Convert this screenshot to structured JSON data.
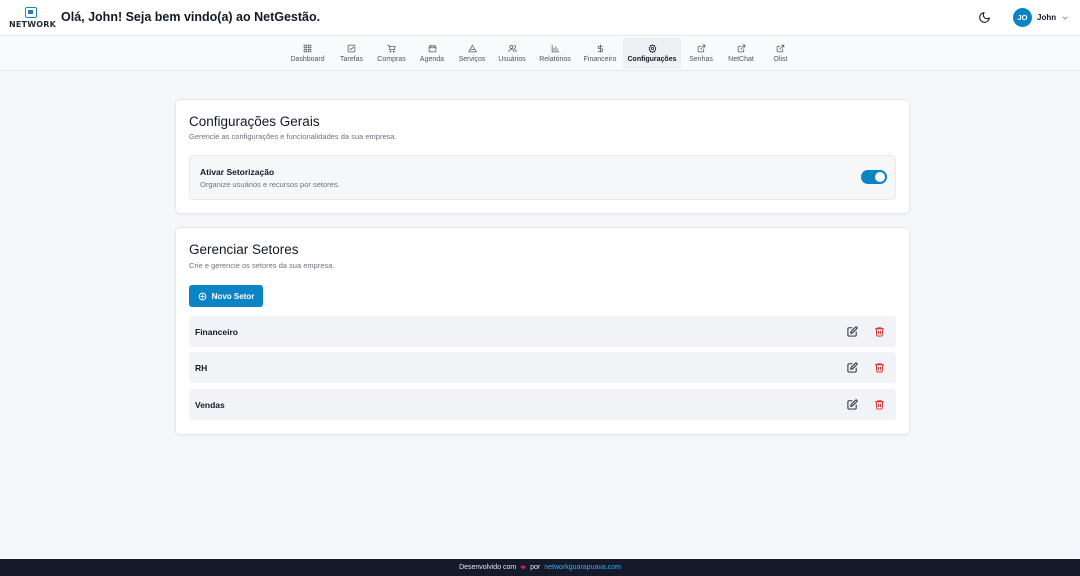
{
  "header": {
    "logo_text": "NETWORK",
    "greeting": "Olá, John! Seja bem vindo(a) ao NetGestão.",
    "user": {
      "initials": "JO",
      "name": "John"
    }
  },
  "nav": {
    "items": [
      {
        "label": "Dashboard",
        "icon": "dashboard-icon"
      },
      {
        "label": "Tarefas",
        "icon": "edit-icon"
      },
      {
        "label": "Compras",
        "icon": "cart-icon"
      },
      {
        "label": "Agenda",
        "icon": "calendar-icon"
      },
      {
        "label": "Serviços",
        "icon": "triangle-icon"
      },
      {
        "label": "Usuários",
        "icon": "users-icon"
      },
      {
        "label": "Relatórios",
        "icon": "chart-icon"
      },
      {
        "label": "Financeiro",
        "icon": "dollar-icon"
      },
      {
        "label": "Configurações",
        "icon": "gear-icon",
        "active": true
      },
      {
        "label": "Senhas",
        "icon": "external-link-icon"
      },
      {
        "label": "NetChat",
        "icon": "external-link-icon"
      },
      {
        "label": "Olist",
        "icon": "external-link-icon"
      }
    ]
  },
  "general": {
    "title": "Configurações Gerais",
    "subtitle": "Gerencie as configurações e funcionalidades da sua empresa.",
    "setting": {
      "title": "Ativar Setorização",
      "description": "Organize usuários e recursos por setores.",
      "enabled": true
    }
  },
  "sectors": {
    "title": "Gerenciar Setores",
    "subtitle": "Crie e gerencie os setores da sua empresa.",
    "new_button": "Novo Setor",
    "items": [
      {
        "name": "Financeiro"
      },
      {
        "name": "RH"
      },
      {
        "name": "Vendas"
      }
    ]
  },
  "footer": {
    "text": "Desenvolvido com",
    "by": "por",
    "link": "networkguarapuava.com"
  },
  "colors": {
    "accent": "#0b84c6",
    "danger": "#dc2626",
    "footer_bg": "#141a2a"
  }
}
